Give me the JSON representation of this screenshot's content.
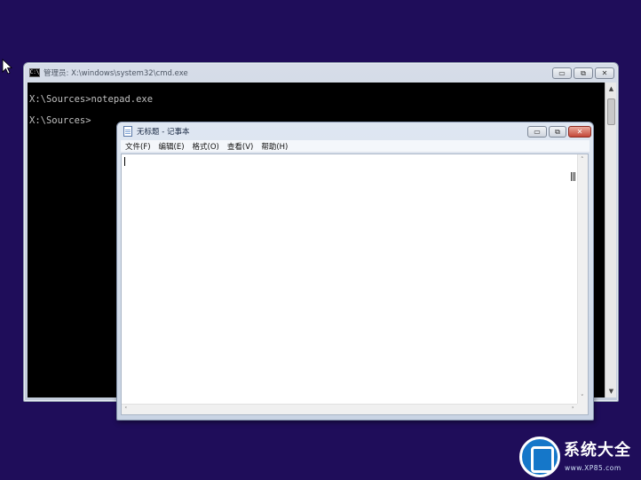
{
  "desktop": {
    "background": "#1f0d5a"
  },
  "cmd": {
    "icon_text": "C:\\",
    "title": "管理员: X:\\windows\\system32\\cmd.exe",
    "lines": [
      "X:\\Sources>notepad.exe",
      "X:\\Sources>"
    ],
    "controls": {
      "minimize": "▭",
      "maximize": "⧉",
      "close": "✕"
    }
  },
  "notepad": {
    "title": "无标题 - 记事本",
    "menu": [
      "文件(F)",
      "编辑(E)",
      "格式(O)",
      "查看(V)",
      "帮助(H)"
    ],
    "content": "",
    "controls": {
      "minimize": "▭",
      "maximize": "⧉",
      "close": "✕"
    }
  },
  "watermark": {
    "name": "系统大全",
    "url": "www.XP85.com",
    "color": "#1577c9"
  }
}
